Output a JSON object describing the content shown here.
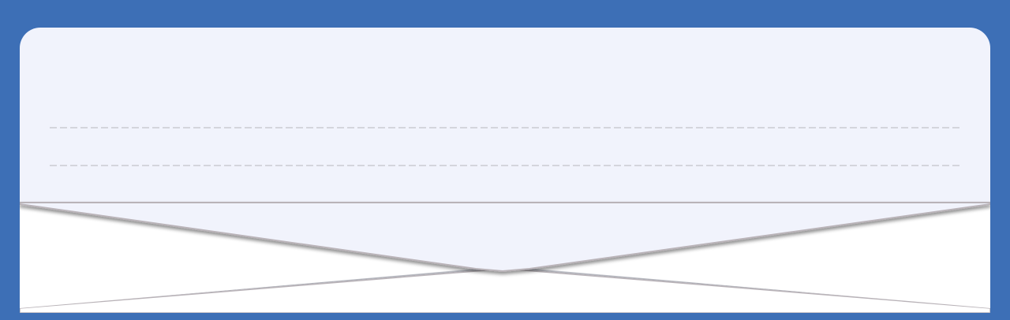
{
  "colors": {
    "background": "#3d6fb6",
    "letter_paper": "#f1f3fc",
    "envelope_body": "#ffffff",
    "fold_shadow": "#b9b3b8",
    "rule_line": "#b7b7bb"
  },
  "letter": {
    "lines": [
      "",
      "",
      "",
      ""
    ]
  }
}
